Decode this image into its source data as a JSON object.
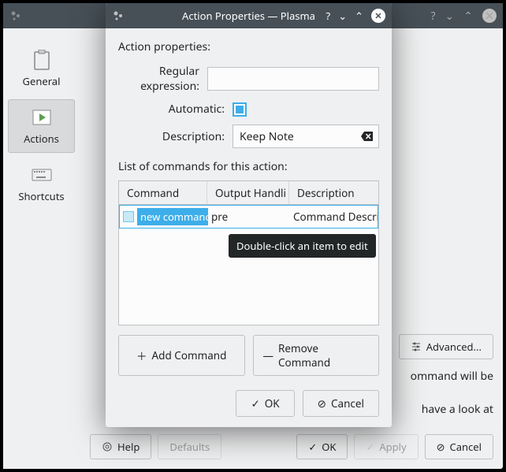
{
  "background_window": {
    "sidebar": {
      "items": [
        {
          "label": "General"
        },
        {
          "label": "Actions"
        },
        {
          "label": "Shortcuts"
        }
      ]
    },
    "partial_button": "Advanced...",
    "partial_text_1": "ommand will be",
    "partial_text_2": "have a look at",
    "footer": {
      "help": "Help",
      "defaults": "Defaults",
      "ok": "OK",
      "apply": "Apply",
      "cancel": "Cancel"
    }
  },
  "dialog": {
    "title": "Action Properties — Plasma",
    "section1_label": "Action properties:",
    "regex_label": "Regular expression:",
    "regex_value": "",
    "automatic_label": "Automatic:",
    "automatic_checked": true,
    "description_label": "Description:",
    "description_value": "Keep Note",
    "commands_label": "List of commands for this action:",
    "table": {
      "headers": [
        "Command",
        "Output Handli",
        "Description"
      ],
      "row": {
        "command_editing": "new command",
        "output_suffix": "pre",
        "description": "Command Descri..."
      }
    },
    "tooltip": "Double-click an item to edit",
    "add_btn": "Add Command",
    "remove_btn": "Remove Command",
    "ok_btn": "OK",
    "cancel_btn": "Cancel"
  }
}
